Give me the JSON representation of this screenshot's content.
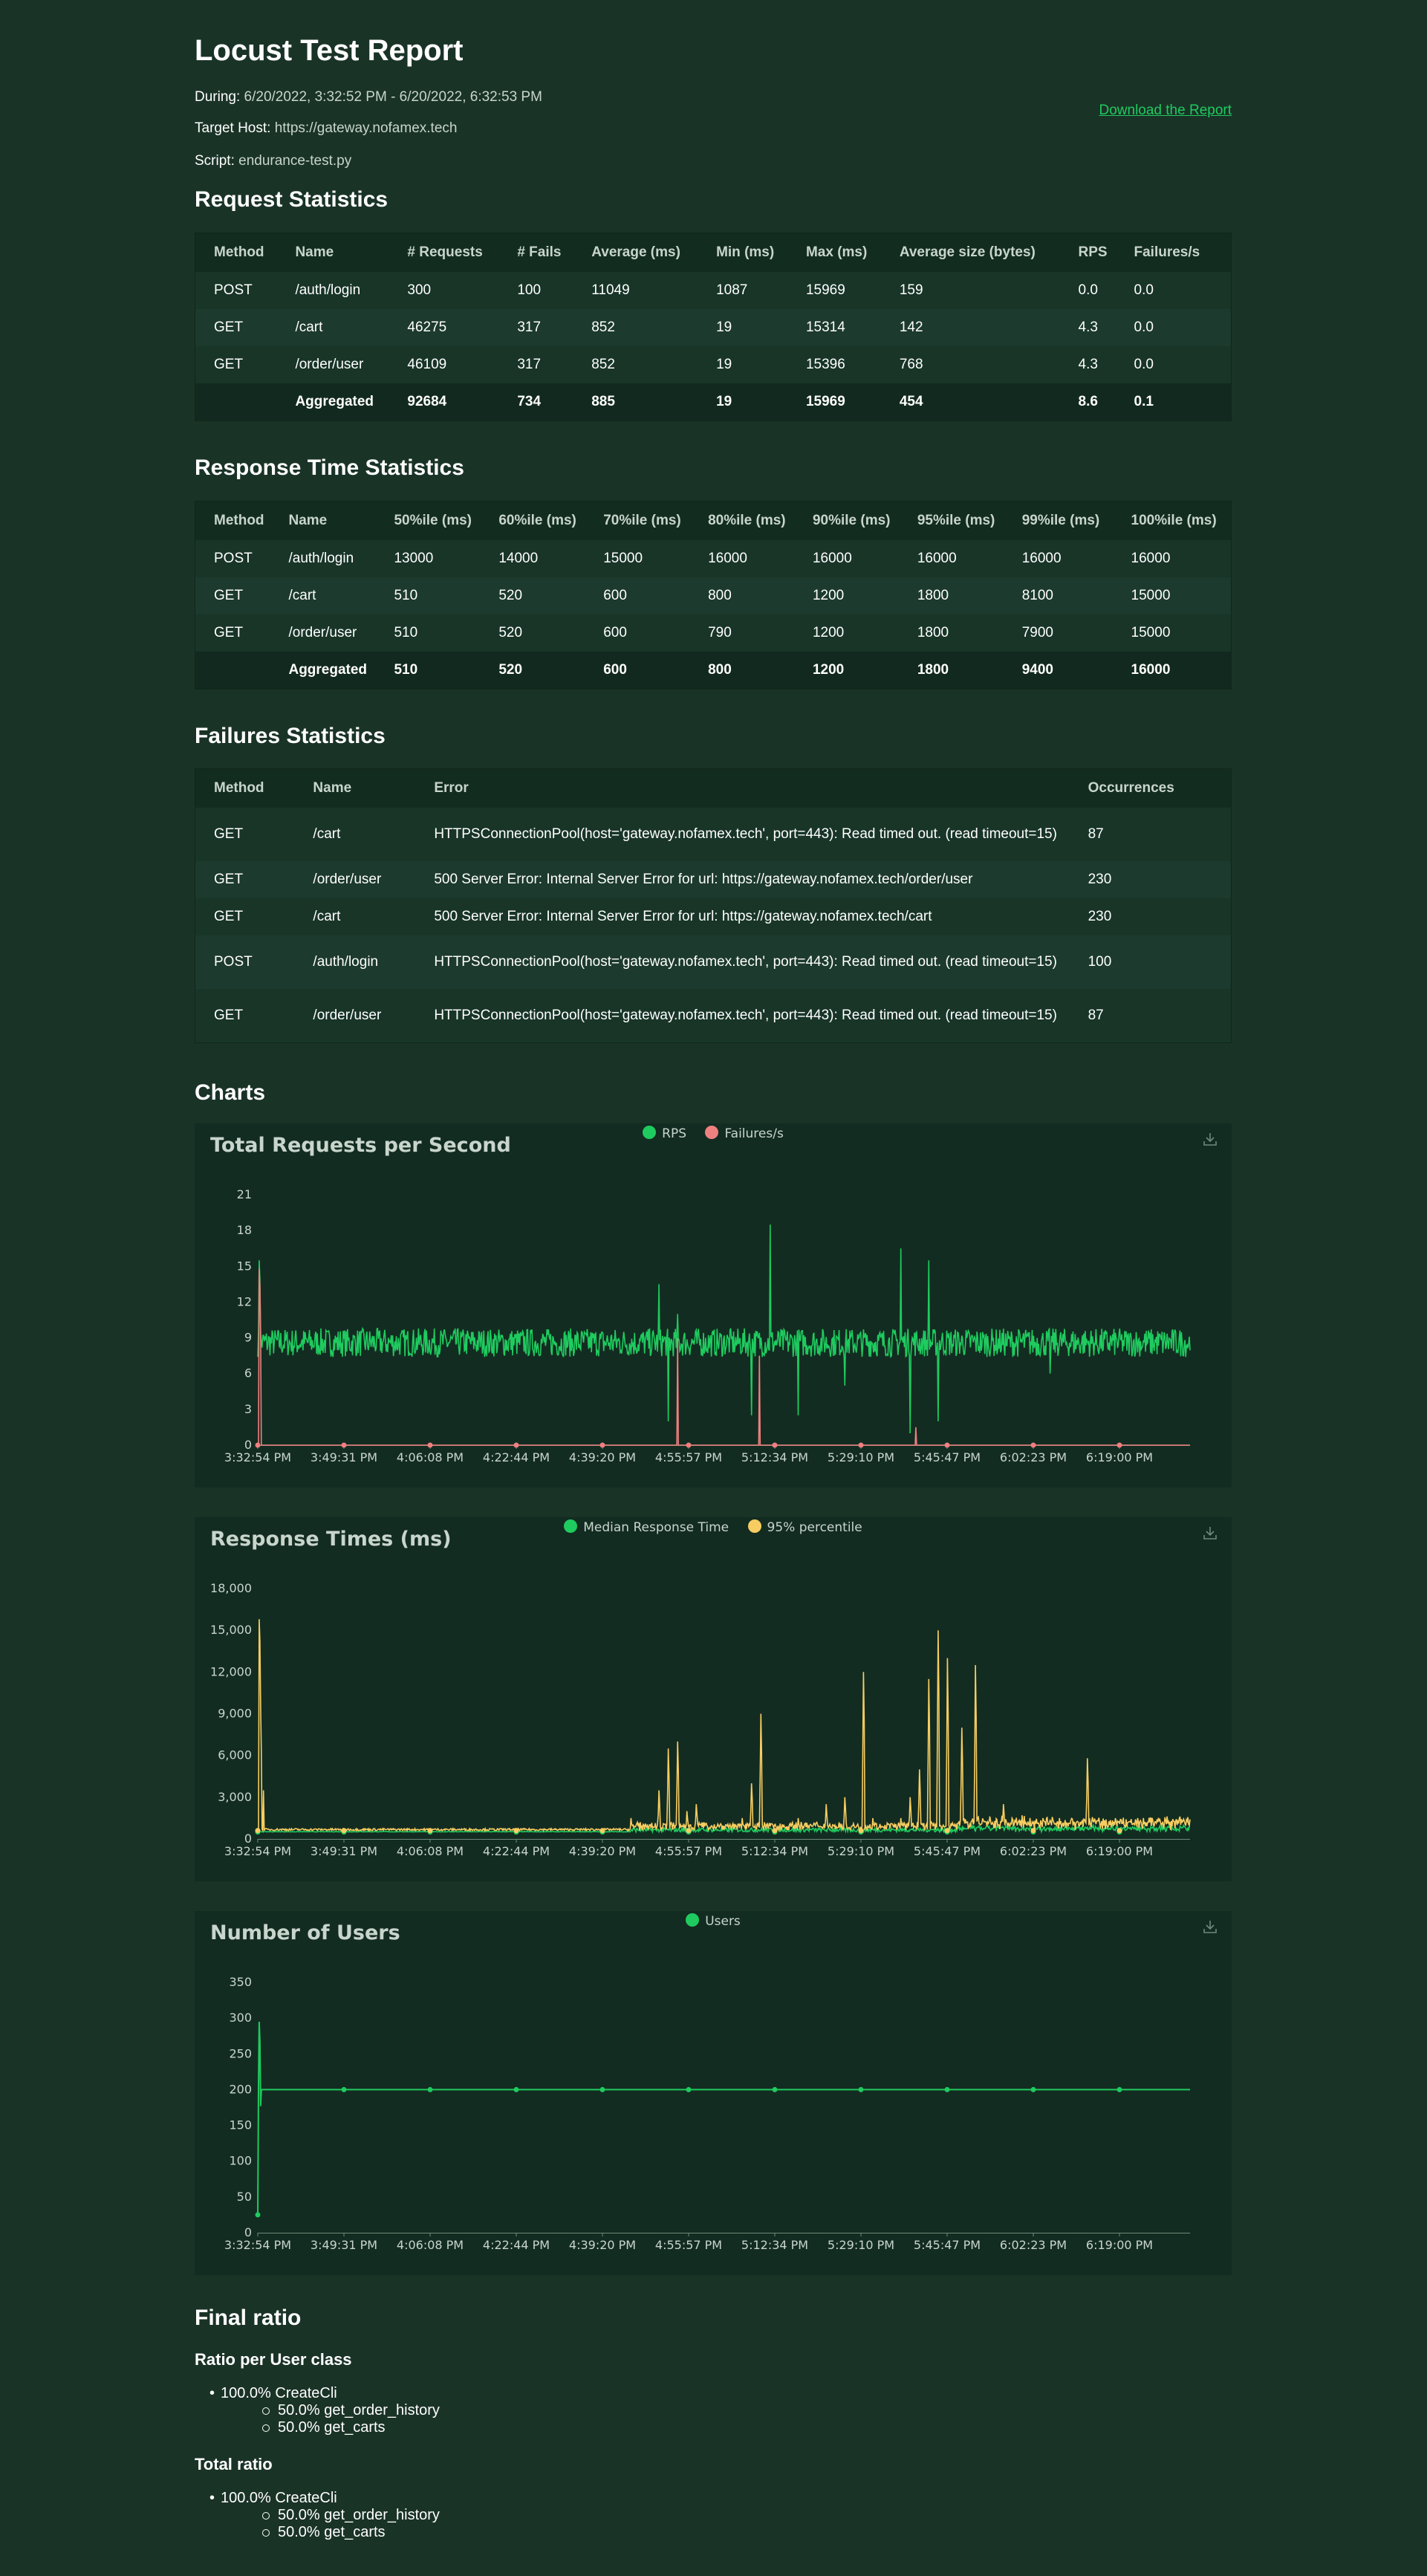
{
  "title": "Locust Test Report",
  "meta": {
    "during_label": "During:",
    "during_value": "6/20/2022, 3:32:52 PM - 6/20/2022, 6:32:53 PM",
    "host_label": "Target Host:",
    "host_value": "https://gateway.nofamex.tech",
    "script_label": "Script:",
    "script_value": "endurance-test.py",
    "download_link": "Download the Report"
  },
  "request_stats": {
    "heading": "Request Statistics",
    "columns": [
      "Method",
      "Name",
      "# Requests",
      "# Fails",
      "Average (ms)",
      "Min (ms)",
      "Max (ms)",
      "Average size (bytes)",
      "RPS",
      "Failures/s"
    ],
    "rows": [
      [
        "POST",
        "/auth/login",
        "300",
        "100",
        "11049",
        "1087",
        "15969",
        "159",
        "0.0",
        "0.0"
      ],
      [
        "GET",
        "/cart",
        "46275",
        "317",
        "852",
        "19",
        "15314",
        "142",
        "4.3",
        "0.0"
      ],
      [
        "GET",
        "/order/user",
        "46109",
        "317",
        "852",
        "19",
        "15396",
        "768",
        "4.3",
        "0.0"
      ],
      [
        "",
        "Aggregated",
        "92684",
        "734",
        "885",
        "19",
        "15969",
        "454",
        "8.6",
        "0.1"
      ]
    ]
  },
  "response_stats": {
    "heading": "Response Time Statistics",
    "columns": [
      "Method",
      "Name",
      "50%ile (ms)",
      "60%ile (ms)",
      "70%ile (ms)",
      "80%ile (ms)",
      "90%ile (ms)",
      "95%ile (ms)",
      "99%ile (ms)",
      "100%ile (ms)"
    ],
    "rows": [
      [
        "POST",
        "/auth/login",
        "13000",
        "14000",
        "15000",
        "16000",
        "16000",
        "16000",
        "16000",
        "16000"
      ],
      [
        "GET",
        "/cart",
        "510",
        "520",
        "600",
        "800",
        "1200",
        "1800",
        "8100",
        "15000"
      ],
      [
        "GET",
        "/order/user",
        "510",
        "520",
        "600",
        "790",
        "1200",
        "1800",
        "7900",
        "15000"
      ],
      [
        "",
        "Aggregated",
        "510",
        "520",
        "600",
        "800",
        "1200",
        "1800",
        "9400",
        "16000"
      ]
    ]
  },
  "failure_stats": {
    "heading": "Failures Statistics",
    "columns": [
      "Method",
      "Name",
      "Error",
      "Occurrences"
    ],
    "rows": [
      [
        "GET",
        "/cart",
        "HTTPSConnectionPool(host='gateway.nofamex.tech', port=443): Read timed out. (read timeout=15)",
        "87"
      ],
      [
        "GET",
        "/order/user",
        "500 Server Error: Internal Server Error for url: https://gateway.nofamex.tech/order/user",
        "230"
      ],
      [
        "GET",
        "/cart",
        "500 Server Error: Internal Server Error for url: https://gateway.nofamex.tech/cart",
        "230"
      ],
      [
        "POST",
        "/auth/login",
        "HTTPSConnectionPool(host='gateway.nofamex.tech', port=443): Read timed out. (read timeout=15)",
        "100"
      ],
      [
        "GET",
        "/order/user",
        "HTTPSConnectionPool(host='gateway.nofamex.tech', port=443): Read timed out. (read timeout=15)",
        "87"
      ]
    ]
  },
  "charts_heading": "Charts",
  "colors": {
    "green": "#1fcb5f",
    "red": "#f08080",
    "yellow": "#f7cd61",
    "bg": "#1a3327",
    "panel": "#132c21"
  },
  "chart_data": [
    {
      "type": "line",
      "title": "Total Requests per Second",
      "x_ticks": [
        "3:32:54 PM",
        "3:49:31 PM",
        "4:06:08 PM",
        "4:22:44 PM",
        "4:39:20 PM",
        "4:55:57 PM",
        "5:12:34 PM",
        "5:29:10 PM",
        "5:45:47 PM",
        "6:02:23 PM",
        "6:19:00 PM"
      ],
      "y_ticks": [
        "0",
        "3",
        "6",
        "12",
        "15",
        "18",
        "21"
      ],
      "y_tick_values": [
        0,
        3,
        6,
        12,
        15,
        18,
        21
      ],
      "y_tick_labels_shown": [
        "0",
        "3",
        "6",
        "9",
        "12",
        "15",
        "18",
        "21"
      ],
      "ylim": [
        0,
        21
      ],
      "series": [
        {
          "name": "RPS",
          "color": "#1fcb5f",
          "baseline": 8.6,
          "noise": 1.2,
          "start_spike": 15.5,
          "spikes": [
            [
              0.43,
              13.5
            ],
            [
              0.44,
              2
            ],
            [
              0.45,
              11
            ],
            [
              0.53,
              2.5
            ],
            [
              0.55,
              18.5
            ],
            [
              0.58,
              2.5
            ],
            [
              0.69,
              16.5
            ],
            [
              0.7,
              1
            ],
            [
              0.72,
              15.5
            ],
            [
              0.73,
              2
            ],
            [
              0.63,
              5
            ],
            [
              0.85,
              6
            ]
          ]
        },
        {
          "name": "Failures/s",
          "color": "#f08080",
          "baseline": 0,
          "start_spike": 14.8,
          "spikes": [
            [
              0.45,
              9
            ],
            [
              0.538,
              7.5
            ],
            [
              0.706,
              1.5
            ]
          ]
        }
      ]
    },
    {
      "type": "line",
      "title": "Response Times (ms)",
      "x_ticks": [
        "3:32:54 PM",
        "3:49:31 PM",
        "4:06:08 PM",
        "4:22:44 PM",
        "4:39:20 PM",
        "4:55:57 PM",
        "5:12:34 PM",
        "5:29:10 PM",
        "5:45:47 PM",
        "6:02:23 PM",
        "6:19:00 PM"
      ],
      "y_tick_values": [
        0,
        3000,
        6000,
        9000,
        12000,
        15000,
        18000
      ],
      "y_tick_labels_shown": [
        "0",
        "3,000",
        "6,000",
        "9,000",
        "12,000",
        "15,000",
        "18,000"
      ],
      "ylim": [
        0,
        18000
      ],
      "series": [
        {
          "name": "Median Response Time",
          "color": "#1fcb5f",
          "baseline": 500
        },
        {
          "name": "95% percentile",
          "color": "#f7cd61",
          "baseline": 600,
          "start_spike": 15800,
          "spikes": [
            [
              0.4,
              1500
            ],
            [
              0.41,
              1200
            ],
            [
              0.43,
              3500
            ],
            [
              0.44,
              6500
            ],
            [
              0.45,
              7000
            ],
            [
              0.46,
              2000
            ],
            [
              0.47,
              2500
            ],
            [
              0.52,
              1500
            ],
            [
              0.53,
              4000
            ],
            [
              0.54,
              9000
            ],
            [
              0.58,
              1500
            ],
            [
              0.61,
              2500
            ],
            [
              0.63,
              3000
            ],
            [
              0.65,
              12000
            ],
            [
              0.66,
              1500
            ],
            [
              0.69,
              1500
            ],
            [
              0.7,
              3000
            ],
            [
              0.71,
              5000
            ],
            [
              0.72,
              11500
            ],
            [
              0.73,
              15000
            ],
            [
              0.74,
              13000
            ],
            [
              0.755,
              8000
            ],
            [
              0.77,
              12500
            ],
            [
              0.8,
              2500
            ],
            [
              0.82,
              1700
            ],
            [
              0.86,
              1500
            ],
            [
              0.89,
              5800
            ],
            [
              0.91,
              1400
            ],
            [
              0.95,
              1500
            ],
            [
              0.98,
              1300
            ]
          ]
        }
      ]
    },
    {
      "type": "line",
      "title": "Number of Users",
      "x_ticks": [
        "3:32:54 PM",
        "3:49:31 PM",
        "4:06:08 PM",
        "4:22:44 PM",
        "4:39:20 PM",
        "4:55:57 PM",
        "5:12:34 PM",
        "5:29:10 PM",
        "5:45:47 PM",
        "6:02:23 PM",
        "6:19:00 PM"
      ],
      "y_tick_values": [
        0,
        50,
        100,
        150,
        200,
        250,
        300,
        350
      ],
      "y_tick_labels_shown": [
        "0",
        "50",
        "100",
        "150",
        "200",
        "250",
        "300",
        "350"
      ],
      "ylim": [
        0,
        350
      ],
      "series": [
        {
          "name": "Users",
          "color": "#1fcb5f",
          "baseline": 200,
          "start_value": 25,
          "start_spike": 295
        }
      ]
    }
  ],
  "final_ratio": {
    "heading": "Final ratio",
    "per_class_heading": "Ratio per User class",
    "per_class": {
      "top": "100.0% CreateCli",
      "sub": [
        "50.0% get_order_history",
        "50.0% get_carts"
      ]
    },
    "total_heading": "Total ratio",
    "total": {
      "top": "100.0% CreateCli",
      "sub": [
        "50.0% get_order_history",
        "50.0% get_carts"
      ]
    }
  }
}
